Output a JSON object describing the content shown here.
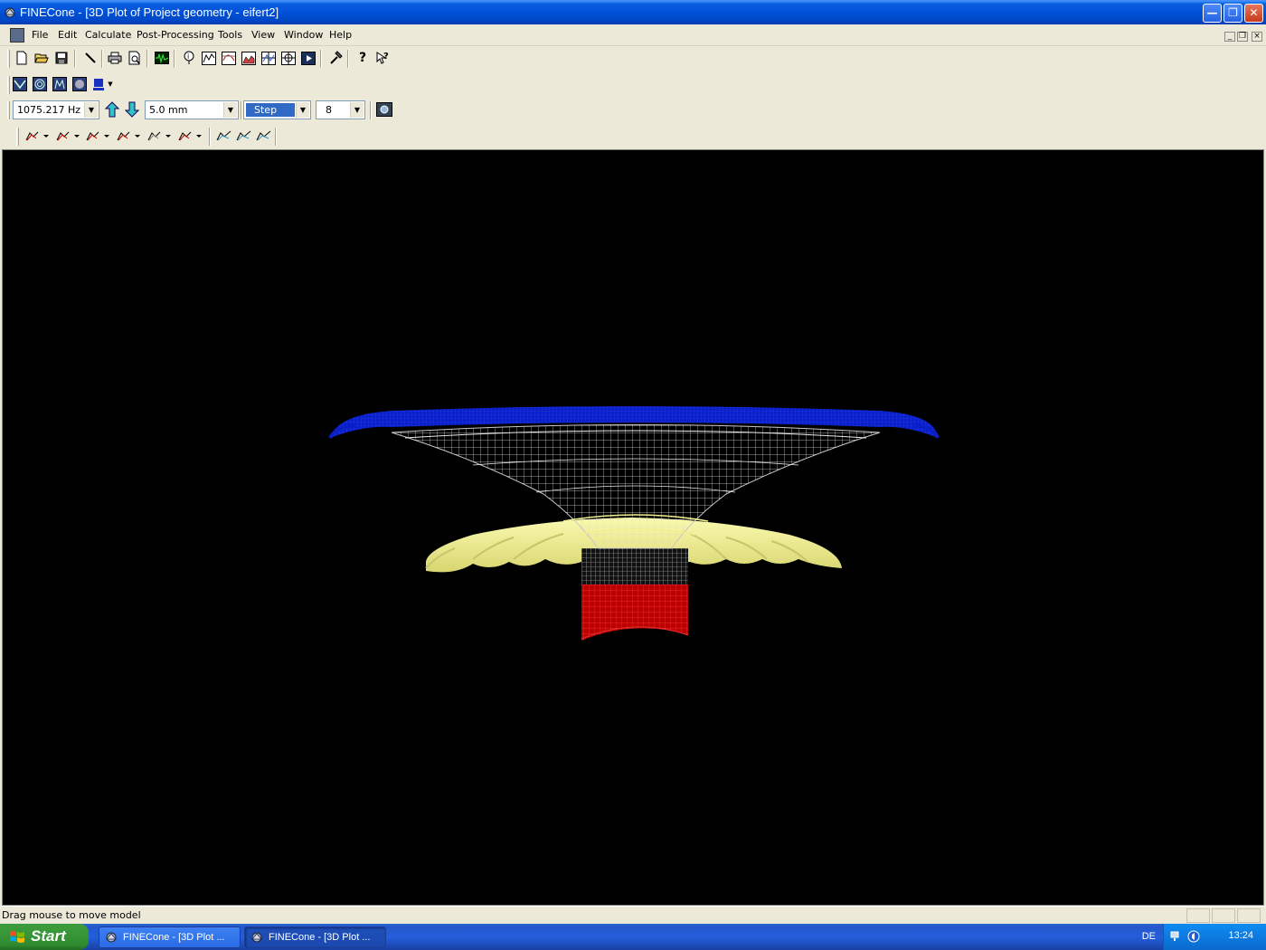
{
  "window": {
    "title": "FINECone - [3D Plot of Project geometry - eifert2]",
    "controls": [
      "minimize",
      "maximize",
      "close"
    ]
  },
  "menubar": {
    "items": [
      "File",
      "Edit",
      "Calculate",
      "Post-Processing",
      "Tools",
      "View",
      "Window",
      "Help"
    ]
  },
  "toolbar_main": {
    "icons": [
      "new-file-icon",
      "open-folder-icon",
      "save-icon",
      "pen-tool-icon",
      "print-icon",
      "print-preview-icon",
      "oscilloscope-icon",
      "info-icon",
      "chart-response-icon",
      "chart-impedance-icon",
      "chart-spl-icon",
      "chart-phase-icon",
      "chart-directivity-icon",
      "animation-play-icon",
      "hammer-icon",
      "help-icon",
      "context-help-icon"
    ]
  },
  "toolbar_view": {
    "icons": [
      "view-cone-icon",
      "view-circle-icon",
      "view-mesh-icon",
      "view-sphere-icon",
      "color-fill-icon",
      "dropdown-arrow-icon"
    ]
  },
  "toolbar_params": {
    "frequency": "1075.217 Hz",
    "step_size": "5.0 mm",
    "mode": "Step",
    "count": "8"
  },
  "toolbar_graphs": {
    "icons": [
      "graph-1-icon",
      "graph-2-icon",
      "graph-3-icon",
      "graph-4-icon",
      "graph-5-icon",
      "graph-6-icon",
      "graph-compare-1-icon",
      "graph-compare-2-icon",
      "graph-compare-3-icon"
    ]
  },
  "viewport": {
    "background": "#000000",
    "surround_color": "#0b20d8",
    "cone_color": "#c8c8c8",
    "spider_color": "#f0ee8a",
    "voice_coil_color": "#d01010"
  },
  "statusbar": {
    "message": "Drag mouse to move model"
  },
  "taskbar": {
    "start_label": "Start",
    "tasks": [
      "FINECone - [3D Plot ...",
      "FINECone - [3D Plot ..."
    ],
    "language": "DE",
    "clock": "13:24"
  }
}
